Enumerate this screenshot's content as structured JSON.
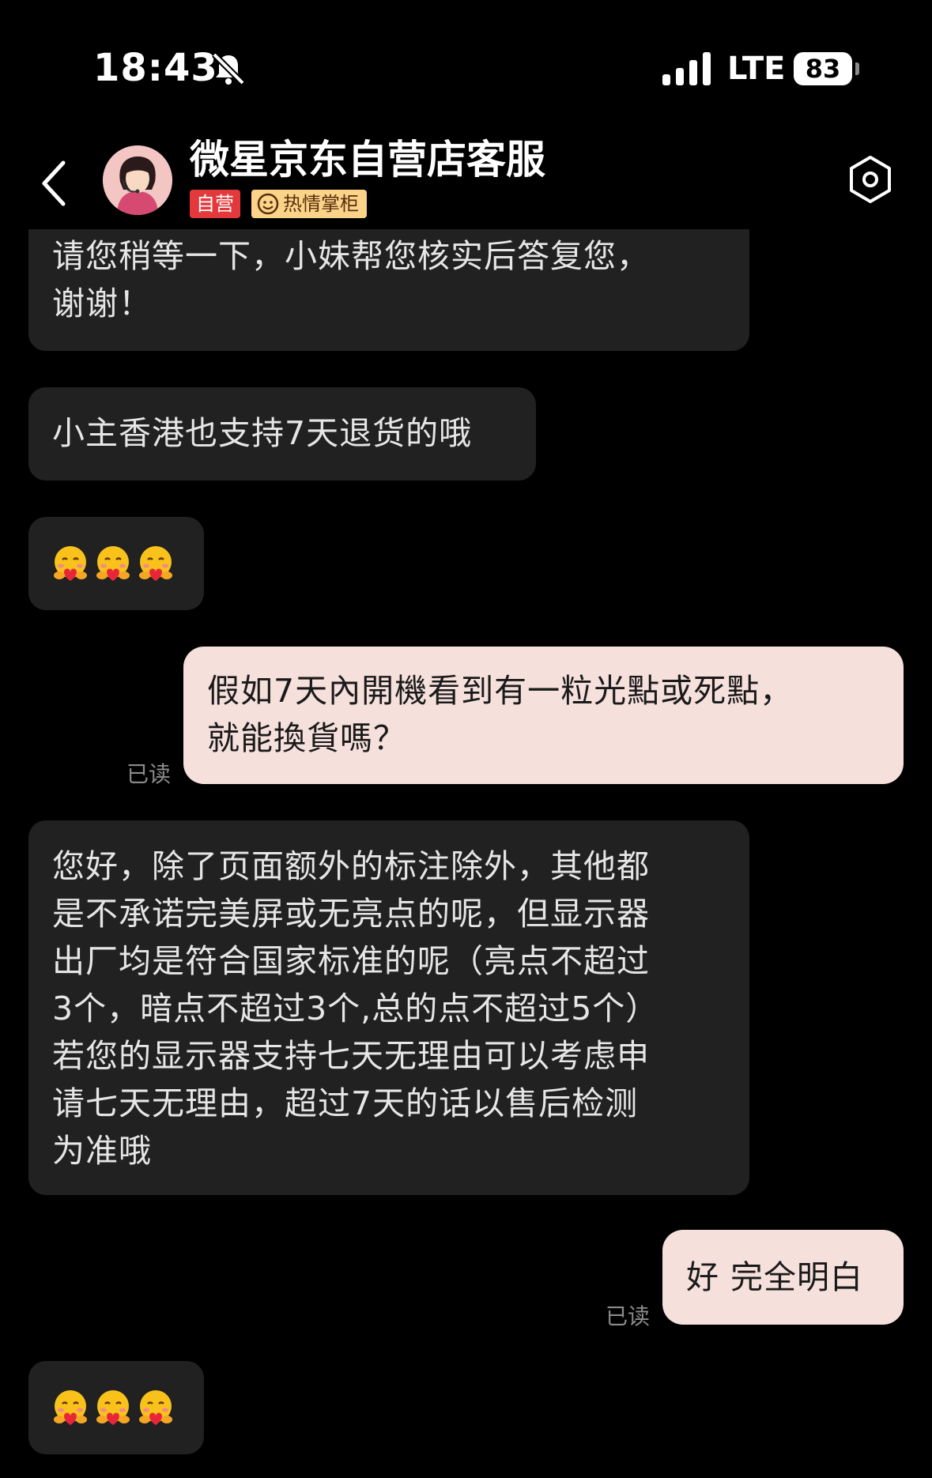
{
  "status_bar": {
    "time": "18:43",
    "network": "LTE",
    "battery": "83"
  },
  "header": {
    "title": "微星京东自营店客服",
    "badge_self": "自营",
    "badge_warm": "热情掌柜"
  },
  "messages": [
    {
      "side": "in",
      "lines": [
        "请您稍等一下，小妹帮您核实后答复您，",
        "谢谢！"
      ]
    },
    {
      "side": "in",
      "lines": [
        "小主香港也支持7天退货的哦"
      ]
    },
    {
      "side": "in",
      "emoji": [
        "hug-emoji",
        "hug-emoji",
        "hug-emoji"
      ]
    },
    {
      "side": "out",
      "lines": [
        "假如7天內開機看到有一粒光點或死點，",
        "就能換貨嗎？"
      ],
      "status": "已读"
    },
    {
      "side": "in",
      "lines": [
        "您好，除了页面额外的标注除外，其他都",
        "是不承诺完美屏或无亮点的呢，但显示器",
        "出厂均是符合国家标准的呢（亮点不超过",
        "3个，暗点不超过3个,总的点不超过5个）",
        "若您的显示器支持七天无理由可以考虑申",
        "请七天无理由，超过7天的话以售后检测",
        "为准哦"
      ]
    },
    {
      "side": "out",
      "lines": [
        "好 完全明白"
      ],
      "status": "已读"
    },
    {
      "side": "in",
      "emoji": [
        "hug-emoji",
        "hug-emoji",
        "hug-emoji"
      ]
    }
  ],
  "colors": {
    "background": "#000000",
    "incoming_bubble": "#212121",
    "outgoing_bubble": "#f5e0dc",
    "badge_self": "#e4393c",
    "badge_warm": "#fbd48a"
  }
}
